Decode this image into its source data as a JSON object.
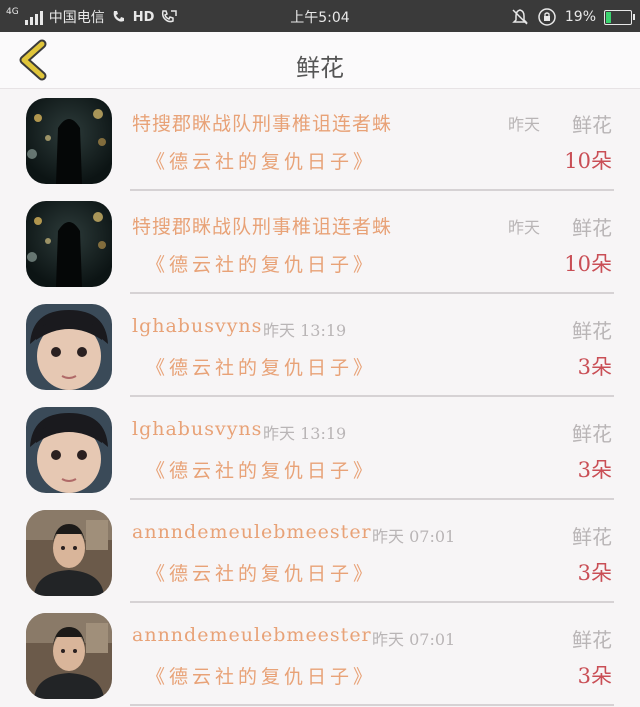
{
  "status_bar": {
    "network": "4G",
    "carrier": "中国电信",
    "hd": "HD",
    "time": "上午5:04",
    "battery": "19%",
    "battery_level": 0.19,
    "icons": [
      "signal-icon",
      "hd-call-icon",
      "call-forward-icon",
      "bell-muted-icon",
      "rotation-lock-icon",
      "battery-icon"
    ]
  },
  "header": {
    "title": "鲜花",
    "back_icon": "chevron-left-icon",
    "accent": "#e0c53a"
  },
  "items": [
    {
      "name": "特搜郡眯战队刑事椎诅连者蛛",
      "time": "昨天",
      "gift": "鲜花",
      "subtitle": "《德云社的复仇日子》",
      "count": "10朵",
      "avatar": "night-girl"
    },
    {
      "name": "特搜郡眯战队刑事椎诅连者蛛",
      "time": "昨天",
      "gift": "鲜花",
      "subtitle": "《德云社的复仇日子》",
      "count": "10朵",
      "avatar": "night-girl"
    },
    {
      "name": "lghabusvyns",
      "time": "昨天 13:19",
      "gift": "鲜花",
      "subtitle": "《德云社的复仇日子》",
      "count": "3朵",
      "avatar": "child"
    },
    {
      "name": "lghabusvyns",
      "time": "昨天 13:19",
      "gift": "鲜花",
      "subtitle": "《德云社的复仇日子》",
      "count": "3朵",
      "avatar": "child"
    },
    {
      "name": "annndemeulebmeester",
      "time": "昨天 07:01",
      "gift": "鲜花",
      "subtitle": "《德云社的复仇日子》",
      "count": "3朵",
      "avatar": "man"
    },
    {
      "name": "annndemeulebmeester",
      "time": "昨天 07:01",
      "gift": "鲜花",
      "subtitle": "《德云社的复仇日子》",
      "count": "3朵",
      "avatar": "man"
    }
  ]
}
